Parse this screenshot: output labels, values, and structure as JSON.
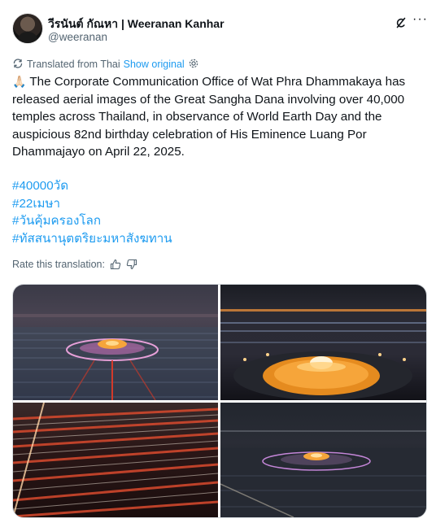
{
  "author": {
    "display_name": "วีรนันต์ กัณหา | Weeranan Kanhar",
    "handle": "@weeranan"
  },
  "translation": {
    "label": "Translated from Thai",
    "show_original": "Show original"
  },
  "post": {
    "emoji": "🙏🏻",
    "text": "The Corporate Communication Office of Wat Phra Dhammakaya has released aerial images of the Great Sangha Dana involving over 40,000 temples across Thailand, in observance of World Earth Day and the auspicious 82nd birthday celebration of His Eminence Luang Por Dhammajayo on April 22, 2025.",
    "hashtags": [
      "#40000วัด",
      "#22เมษา",
      "#วันคุ้มครองโลก",
      "#ทัสสนานุตตริยะมหาสังฆทาน"
    ]
  },
  "rate": {
    "label": "Rate this translation:"
  },
  "icons": {
    "grok": "grok-icon",
    "more": "more-icon",
    "translate": "translate-icon",
    "gear": "gear-icon",
    "thumbs_up": "thumbs-up-icon",
    "thumbs_down": "thumbs-down-icon"
  },
  "colors": {
    "link": "#1d9bf0",
    "secondary_text": "#536471",
    "primary_text": "#0f1419"
  }
}
